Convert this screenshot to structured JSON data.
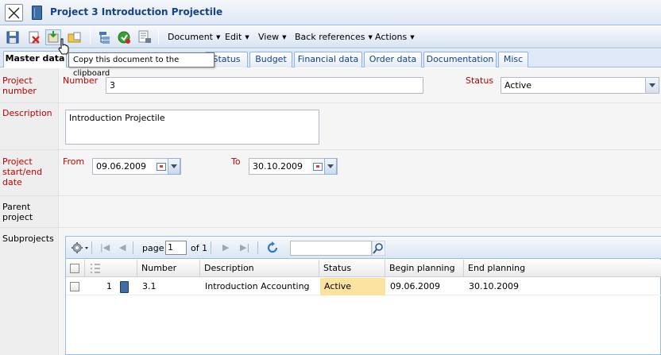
{
  "window": {
    "title": "Project 3 Introduction Projectile"
  },
  "toolbar": {
    "menus": [
      "Document",
      "Edit",
      "View",
      "Back references",
      "Actions"
    ],
    "tooltip": "Copy this document to the clipboard"
  },
  "tabs": [
    "Master data",
    "Status",
    "Budget",
    "Financial data",
    "Order data",
    "Documentation",
    "Misc"
  ],
  "form": {
    "project_number_label": "Project number",
    "number_label": "Number",
    "number_value": "3",
    "status_label": "Status",
    "status_value": "Active",
    "description_label": "Description",
    "description_value": "Introduction Projectile",
    "dates_label": "Project start/end date",
    "from_label": "From",
    "from_value": "09.06.2009",
    "to_label": "To",
    "to_value": "30.10.2009",
    "parent_label": "Parent project",
    "subprojects_label": "Subprojects"
  },
  "grid": {
    "page_label": "page",
    "page_value": "1",
    "of_label": "of 1",
    "columns": [
      "Number",
      "Description",
      "Status",
      "Begin planning",
      "End planning"
    ],
    "rows": [
      {
        "index": "1",
        "number": "3.1",
        "description": "Introduction Accounting",
        "status": "Active",
        "begin": "09.06.2009",
        "end": "30.10.2009"
      }
    ]
  },
  "colors": {
    "accent": "#15428b",
    "required_label": "#c00000",
    "status_highlight": "#fce4a0"
  }
}
